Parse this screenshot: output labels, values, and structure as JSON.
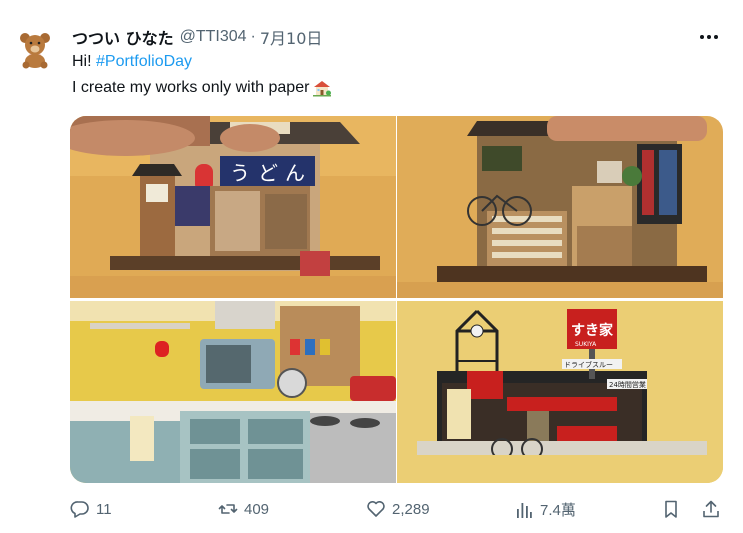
{
  "tweet": {
    "display_name": "つつい ひなた",
    "handle": "@TTI304",
    "separator": "·",
    "date": "7月10日",
    "greeting": "Hi! ",
    "hashtag": "#PortfolioDay",
    "body": "I create my works only with paper",
    "emoji_icon": "house-with-garden"
  },
  "media": {
    "photos": [
      {
        "subject": "paper udon shop diorama",
        "sign_text": [
          "う",
          "ど",
          "ん"
        ]
      },
      {
        "subject": "paper bookshop with bicycle diorama"
      },
      {
        "subject": "paper kitchen diorama"
      },
      {
        "subject": "paper Sukiya drive-through diorama",
        "sign_text": [
          "すき家",
          "SUKIYA",
          "ドライブスルー",
          "24時間営業"
        ]
      }
    ]
  },
  "actions": {
    "replies": "11",
    "retweets": "409",
    "likes": "2,289",
    "views": "7.4萬"
  },
  "colors": {
    "link": "#1d9bf0",
    "text": "#0f1419",
    "muted": "#536471"
  }
}
